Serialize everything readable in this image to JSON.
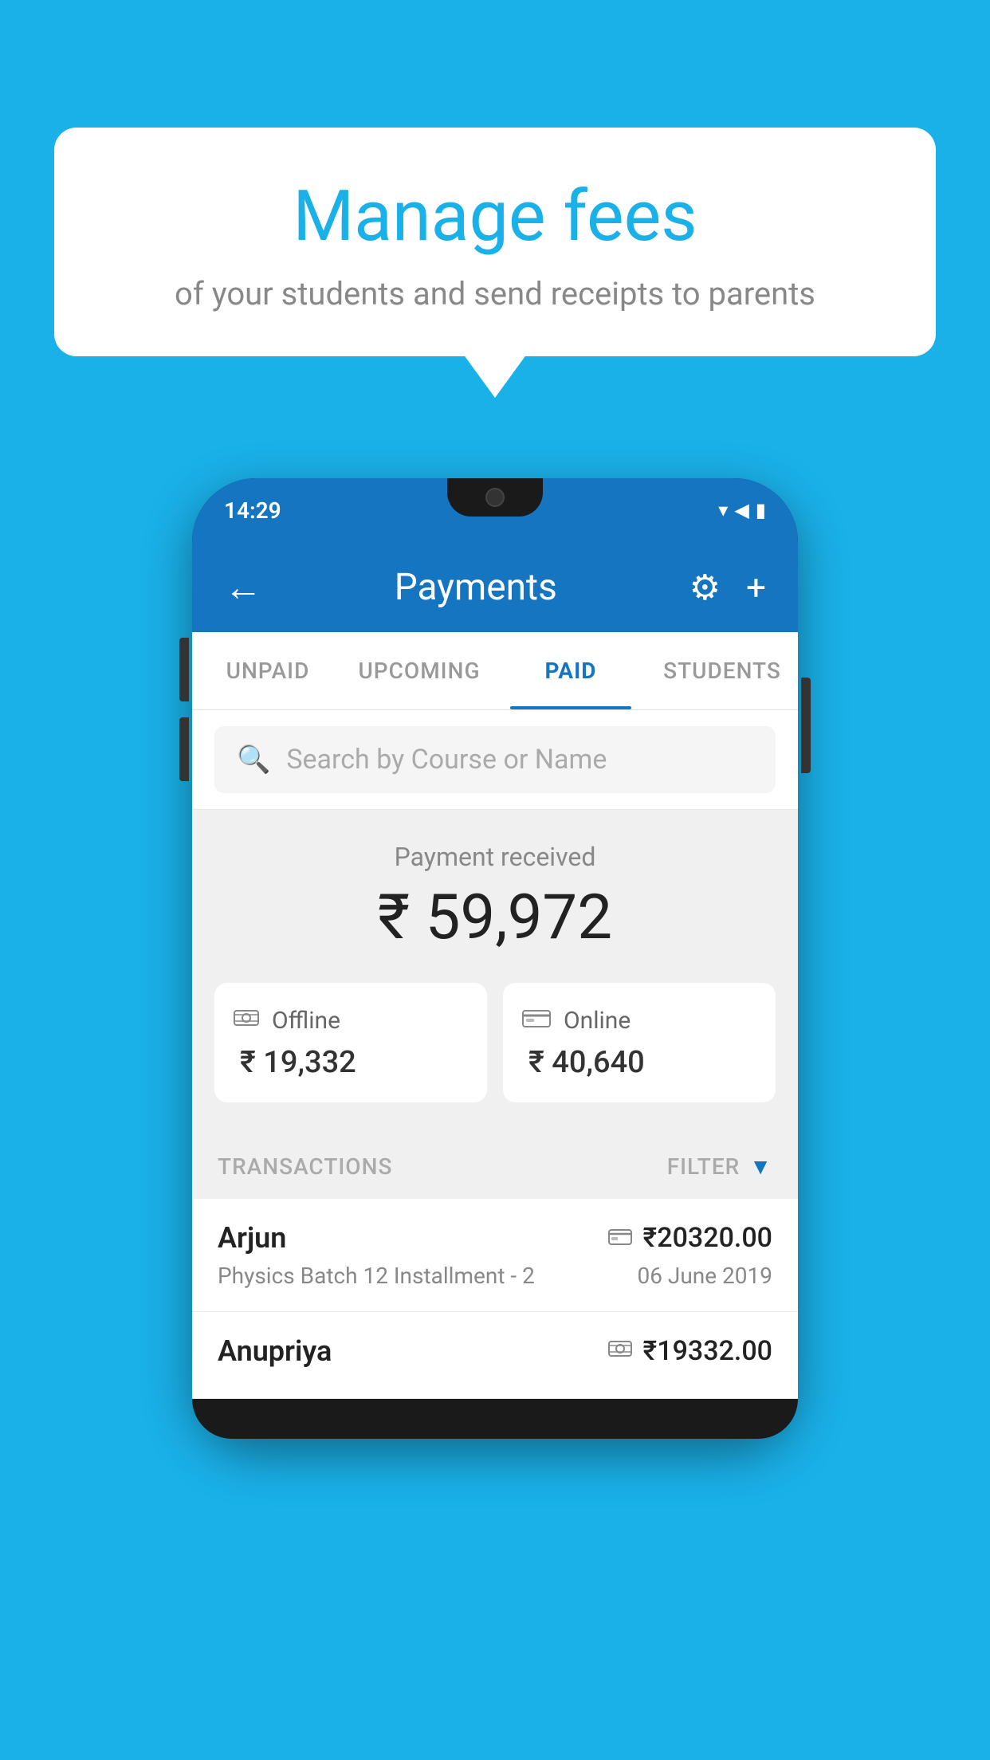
{
  "background_color": "#1ab0e8",
  "speech_bubble": {
    "title": "Manage fees",
    "subtitle": "of your students and send receipts to parents"
  },
  "phone": {
    "status_bar": {
      "time": "14:29",
      "icons": "▼◀▮"
    },
    "header": {
      "back_label": "←",
      "title": "Payments",
      "gear_icon": "⚙",
      "plus_icon": "+"
    },
    "tabs": [
      {
        "label": "UNPAID",
        "active": false
      },
      {
        "label": "UPCOMING",
        "active": false
      },
      {
        "label": "PAID",
        "active": true
      },
      {
        "label": "STUDENTS",
        "active": false
      }
    ],
    "search": {
      "placeholder": "Search by Course or Name"
    },
    "payment_summary": {
      "label": "Payment received",
      "amount": "₹ 59,972",
      "offline": {
        "label": "Offline",
        "amount": "₹ 19,332"
      },
      "online": {
        "label": "Online",
        "amount": "₹ 40,640"
      }
    },
    "transactions": {
      "section_label": "TRANSACTIONS",
      "filter_label": "FILTER",
      "items": [
        {
          "name": "Arjun",
          "detail": "Physics Batch 12 Installment - 2",
          "amount": "₹20320.00",
          "date": "06 June 2019",
          "payment_type": "card"
        },
        {
          "name": "Anupriya",
          "detail": "",
          "amount": "₹19332.00",
          "date": "",
          "payment_type": "cash"
        }
      ]
    }
  }
}
